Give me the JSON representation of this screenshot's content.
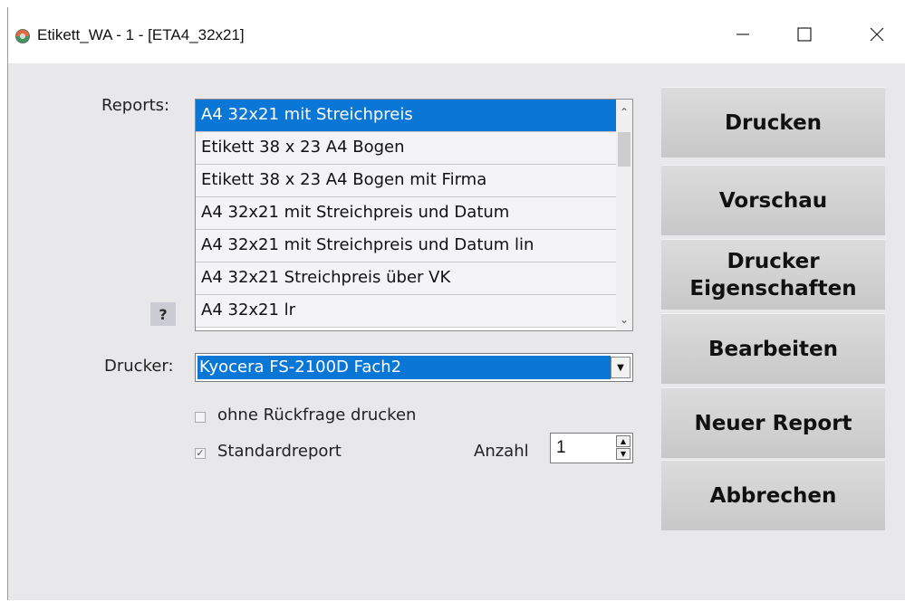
{
  "window": {
    "title": "Etikett_WA - 1 - [ETA4_32x21]",
    "icon": "app-icon",
    "controls": {
      "minimize": "—",
      "maximize": "☐",
      "close": "✕"
    }
  },
  "reports": {
    "label": "Reports:",
    "help_label": "?",
    "items": [
      "A4 32x21 mit Streichpreis",
      "Etikett 38 x 23 A4 Bogen",
      "Etikett 38 x 23 A4 Bogen mit Firma",
      "A4 32x21 mit Streichpreis und Datum",
      "A4 32x21 mit Streichpreis und Datum lin",
      "A4 32x21 Streichpreis über VK",
      "A4 32x21 lr"
    ],
    "selected_index": 0
  },
  "printer": {
    "label": "Drucker:",
    "value": "Kyocera FS-2100D Fach2"
  },
  "options": {
    "no_prompt_label": "ohne Rückfrage drucken",
    "no_prompt_checked": false,
    "standard_label": "Standardreport",
    "standard_checked": true,
    "count_label": "Anzahl",
    "count_value": "1"
  },
  "buttons": {
    "print": "Drucken",
    "preview": "Vorschau",
    "printer_props_line1": "Drucker",
    "printer_props_line2": "Eigenschaften",
    "edit": "Bearbeiten",
    "new_report": "Neuer Report",
    "cancel": "Abbrechen"
  },
  "colors": {
    "selection": "#0a77d6",
    "window_bg": "#e8e8ea",
    "button_bg": "#d4d4d4"
  }
}
